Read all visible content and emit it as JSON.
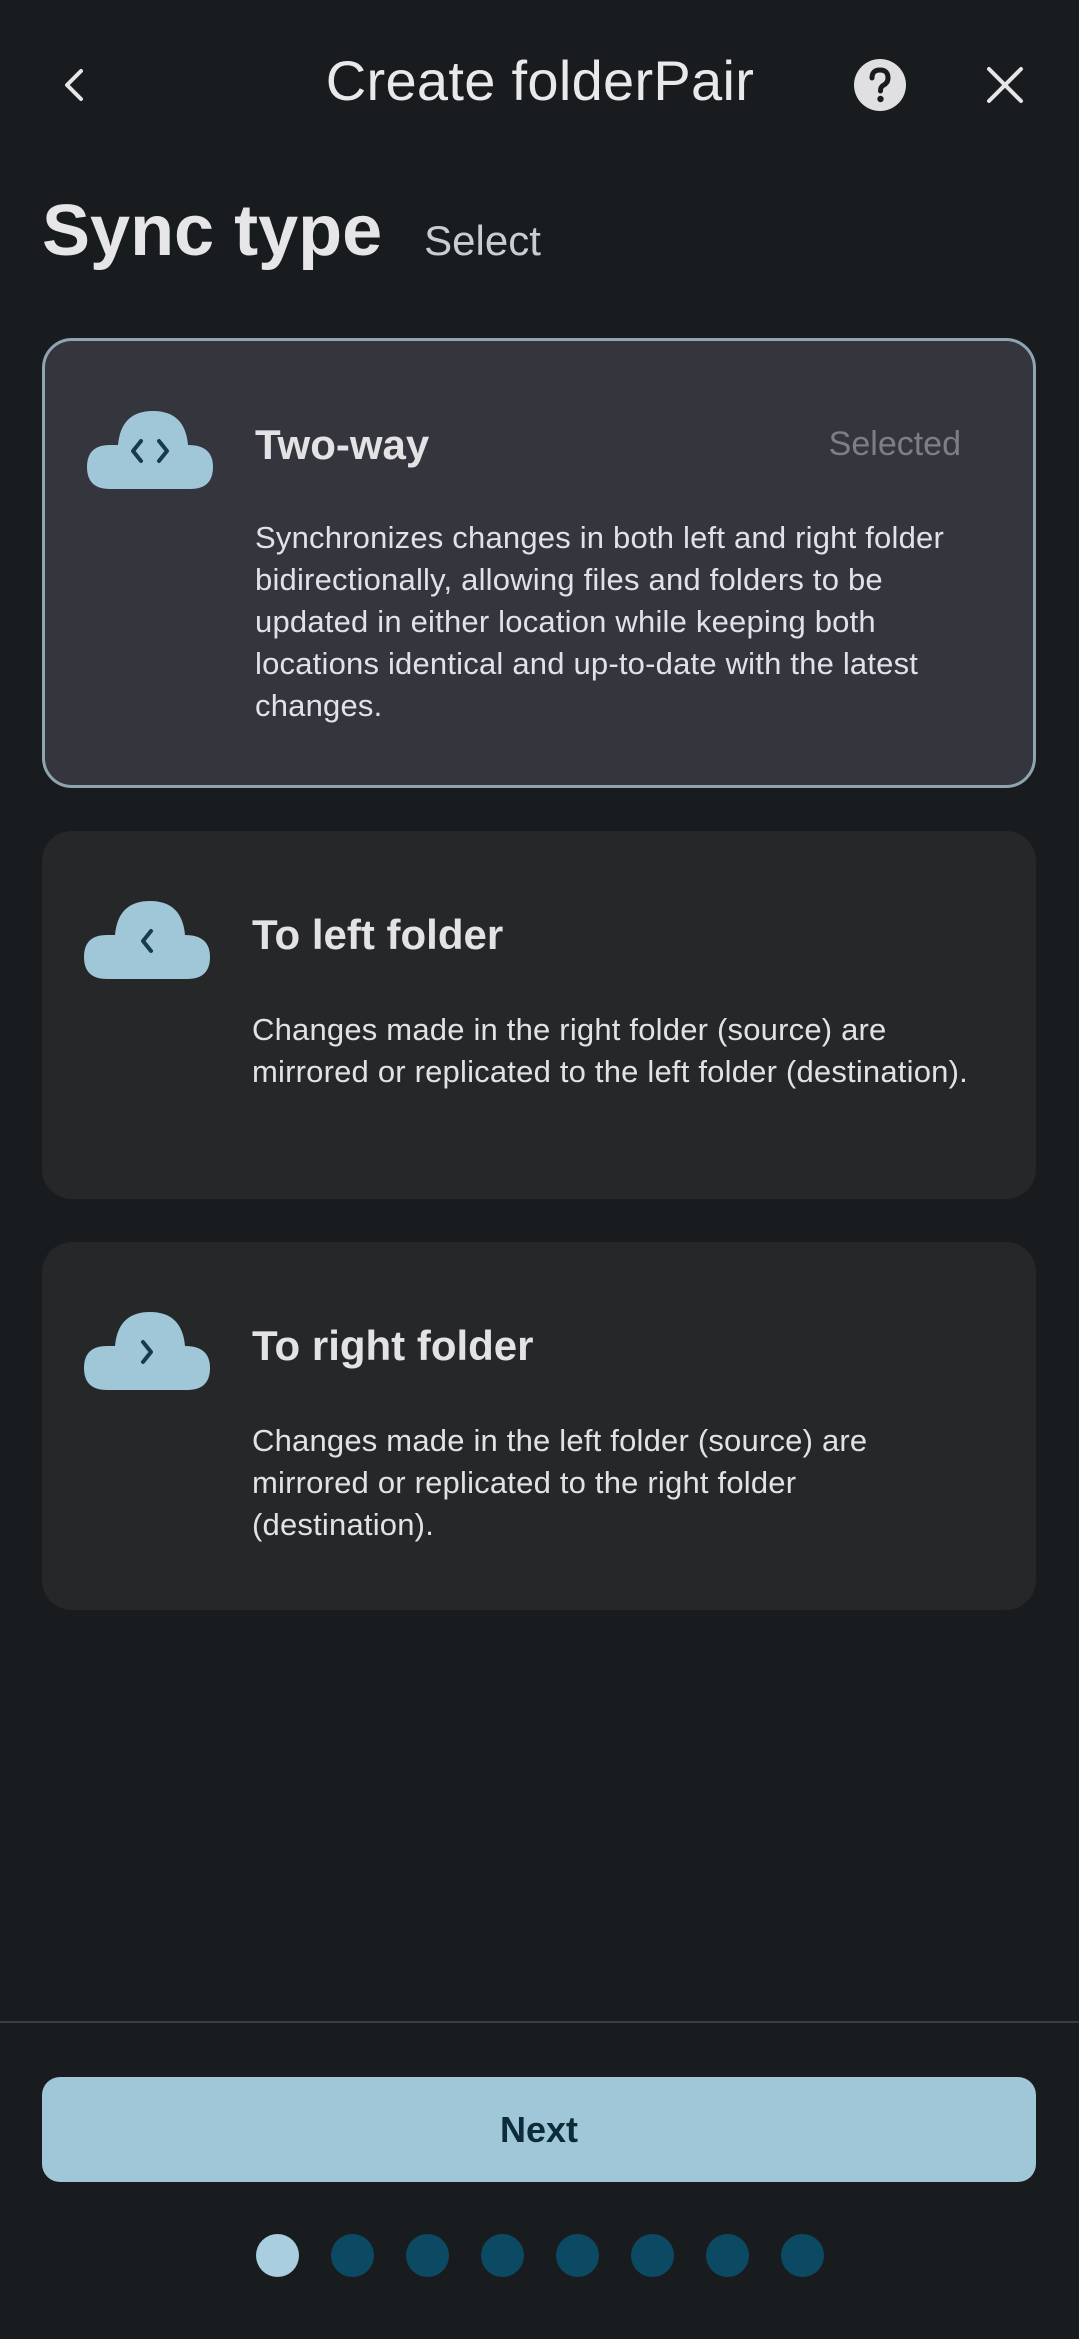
{
  "header": {
    "title": "Create folderPair",
    "back_icon": "chevron-left-icon",
    "help_icon": "help-circle-icon",
    "close_icon": "close-icon"
  },
  "section": {
    "title": "Sync type",
    "subtitle": "Select"
  },
  "options": [
    {
      "title": "Two-way",
      "badge": "Selected",
      "icon": "cloud-bidirectional-icon",
      "description": "Synchronizes changes in both left and right folder bidirectionally, allowing files and folders to be updated in either location while keeping both locations identical and up-to-date with the latest changes.",
      "selected": true
    },
    {
      "title": "To left folder",
      "icon": "cloud-left-arrow-icon",
      "description": "Changes made in the right folder (source) are mirrored or replicated to the left folder (destination).",
      "selected": false
    },
    {
      "title": "To right folder",
      "icon": "cloud-right-arrow-icon",
      "description": "Changes made in the left folder (source) are mirrored or replicated to the right folder (destination).",
      "selected": false
    }
  ],
  "footer": {
    "next_label": "Next",
    "page_count": 8,
    "current_page": 1
  },
  "colors": {
    "background": "#191c1f",
    "accent": "#9fc7d7",
    "selected_card": "#35353d",
    "card": "#262729",
    "dot_inactive": "#0c4a63"
  }
}
